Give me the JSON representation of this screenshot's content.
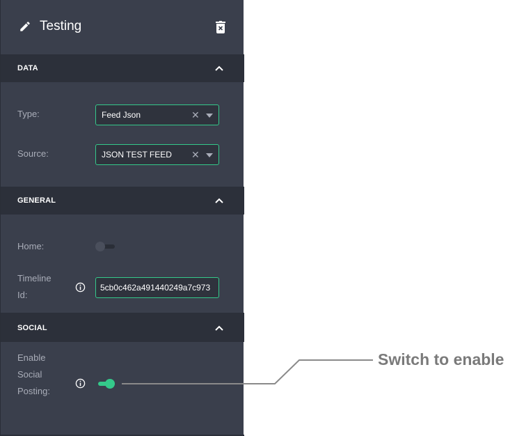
{
  "header": {
    "title": "Testing"
  },
  "sections": {
    "data": {
      "title": "DATA"
    },
    "general": {
      "title": "GENERAL"
    },
    "social": {
      "title": "SOCIAL"
    }
  },
  "fields": {
    "type": {
      "label": "Type:",
      "value": "Feed Json"
    },
    "source": {
      "label": "Source:",
      "value": "JSON TEST FEED"
    },
    "home": {
      "label": "Home:",
      "enabled": false
    },
    "timeline": {
      "label_line1": "Timeline",
      "label_line2": "Id:",
      "value": "5cb0c462a491440249a7c973"
    },
    "social_posting": {
      "label_line1": "Enable",
      "label_line2": "Social",
      "label_line3": "Posting:",
      "enabled": true
    }
  },
  "annotation": {
    "text": "Switch to enable"
  },
  "colors": {
    "panel": "#3a3f4c",
    "section_bar": "#2c303a",
    "accent": "#34c98a"
  },
  "icons": [
    "pencil-icon",
    "trash-icon",
    "chevron-up-icon",
    "clear-icon",
    "caret-down-icon",
    "info-icon"
  ]
}
